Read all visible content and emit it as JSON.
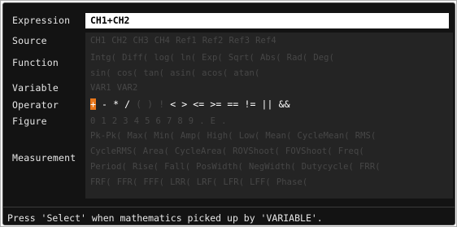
{
  "labels": {
    "expression": "Expression",
    "source": "Source",
    "function": "Function",
    "variable": "Variable",
    "operator": "Operator",
    "figure": "Figure",
    "measurement": "Measurement"
  },
  "expression_value": "CH1+CH2",
  "source_items": [
    "CH1",
    "CH2",
    "CH3",
    "CH4",
    "Ref1",
    "Ref2",
    "Ref3",
    "Ref4"
  ],
  "function_row1": [
    "Intg(",
    "Diff(",
    "log(",
    "ln(",
    "Exp(",
    "Sqrt(",
    "Abs(",
    "Rad(",
    "Deg("
  ],
  "function_row2": [
    "sin(",
    "cos(",
    "tan(",
    "asin(",
    "acos(",
    "atan("
  ],
  "variable_items": [
    "VAR1",
    "VAR2"
  ],
  "operator_items": [
    {
      "label": "+",
      "state": "selected"
    },
    {
      "label": "-",
      "state": "active"
    },
    {
      "label": "*",
      "state": "active"
    },
    {
      "label": "/",
      "state": "active"
    },
    {
      "label": "(",
      "state": "dim"
    },
    {
      "label": ")",
      "state": "dim"
    },
    {
      "label": "!",
      "state": "dim"
    },
    {
      "label": "<",
      "state": "active"
    },
    {
      "label": ">",
      "state": "active"
    },
    {
      "label": "<=",
      "state": "active"
    },
    {
      "label": ">=",
      "state": "active"
    },
    {
      "label": "==",
      "state": "active"
    },
    {
      "label": "!=",
      "state": "active"
    },
    {
      "label": "||",
      "state": "active"
    },
    {
      "label": "&&",
      "state": "active"
    }
  ],
  "figure_items": [
    "0",
    "1",
    "2",
    "3",
    "4",
    "5",
    "6",
    "7",
    "8",
    "9",
    ".",
    "E",
    "."
  ],
  "measurement_row1": [
    "Pk-Pk(",
    "Max(",
    "Min(",
    "Amp(",
    "High(",
    "Low(",
    "Mean(",
    "CycleMean(",
    "RMS("
  ],
  "measurement_row2": [
    "CycleRMS(",
    "Area(",
    "CycleArea(",
    "ROVShoot(",
    "FOVShoot(",
    "Freq("
  ],
  "measurement_row3": [
    "Period(",
    "Rise(",
    "Fall(",
    "PosWidth(",
    "NegWidth(",
    "Dutycycle(",
    "FRR("
  ],
  "measurement_row4": [
    "FRF(",
    "FFR(",
    "FFF(",
    "LRR(",
    "LRF(",
    "LFR(",
    "LFF(",
    "Phase("
  ],
  "status_text": "Press 'Select' when mathematics picked up by 'VARIABLE'.",
  "colors": {
    "background": "#131313",
    "grid": "#242424",
    "selected": "#e8761a",
    "inactive_text": "#474747",
    "active_text": "#ffffff"
  }
}
